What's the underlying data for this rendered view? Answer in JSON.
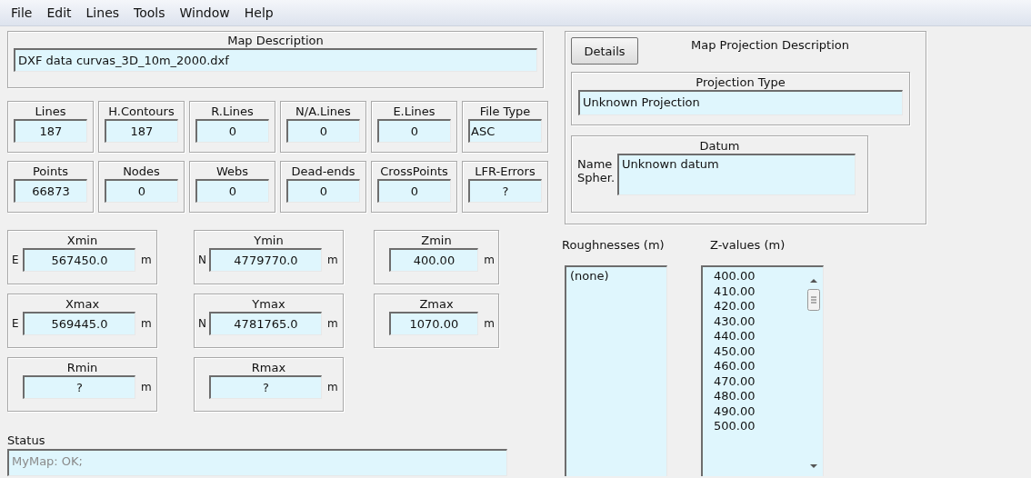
{
  "menu": [
    "File",
    "Edit",
    "Lines",
    "Tools",
    "Window",
    "Help"
  ],
  "map_description": {
    "title": "Map Description",
    "value": "DXF data curvas_3D_10m_2000.dxf"
  },
  "statistics": [
    [
      {
        "label": "Lines",
        "value": "187",
        "kind": "number"
      },
      {
        "label": "H.Contours",
        "value": "187",
        "kind": "number"
      },
      {
        "label": "R.Lines",
        "value": "0",
        "kind": "number"
      },
      {
        "label": "N/A.Lines",
        "value": "0",
        "kind": "number"
      },
      {
        "label": "E.Lines",
        "value": "0",
        "kind": "number"
      },
      {
        "label": "File Type",
        "value": "ASC",
        "kind": "text"
      }
    ],
    [
      {
        "label": "Points",
        "value": "66873",
        "kind": "number"
      },
      {
        "label": "Nodes",
        "value": "0",
        "kind": "number"
      },
      {
        "label": "Webs",
        "value": "0",
        "kind": "number"
      },
      {
        "label": "Dead-ends",
        "value": "0",
        "kind": "number"
      },
      {
        "label": "CrossPoints",
        "value": "0",
        "kind": "number"
      },
      {
        "label": "LFR-Errors",
        "value": "?",
        "kind": "number"
      }
    ]
  ],
  "extents": [
    [
      {
        "label": "Xmin",
        "prefix": "E",
        "value": "567450.0",
        "unit": "m"
      },
      {
        "label": "Ymin",
        "prefix": "N",
        "value": "4779770.0",
        "unit": "m"
      },
      {
        "label": "Zmin",
        "value": "400.00",
        "unit": "m"
      }
    ],
    [
      {
        "label": "Xmax",
        "prefix": "E",
        "value": "569445.0",
        "unit": "m"
      },
      {
        "label": "Ymax",
        "prefix": "N",
        "value": "4781765.0",
        "unit": "m"
      },
      {
        "label": "Zmax",
        "value": "1070.00",
        "unit": "m"
      }
    ],
    [
      {
        "label": "Rmin",
        "value": "?",
        "unit": "m"
      },
      {
        "label": "Rmax",
        "value": "?",
        "unit": "m"
      }
    ]
  ],
  "status": {
    "label": "Status",
    "value": "MyMap: OK;",
    "disabled": true
  },
  "projection": {
    "details_button": "Details",
    "title": "Map Projection Description",
    "projection_type": {
      "title": "Projection Type",
      "value": "Unknown Projection"
    },
    "datum": {
      "title": "Datum",
      "labels": [
        "Name",
        "Spher."
      ],
      "value": "Unknown datum"
    }
  },
  "roughnesses": {
    "title": "Roughnesses (m)",
    "items": [
      "(none)"
    ]
  },
  "z_values": {
    "title": "Z-values (m)",
    "items": [
      "400.00",
      "410.00",
      "420.00",
      "430.00",
      "440.00",
      "450.00",
      "460.00",
      "470.00",
      "480.00",
      "490.00",
      "500.00"
    ]
  }
}
